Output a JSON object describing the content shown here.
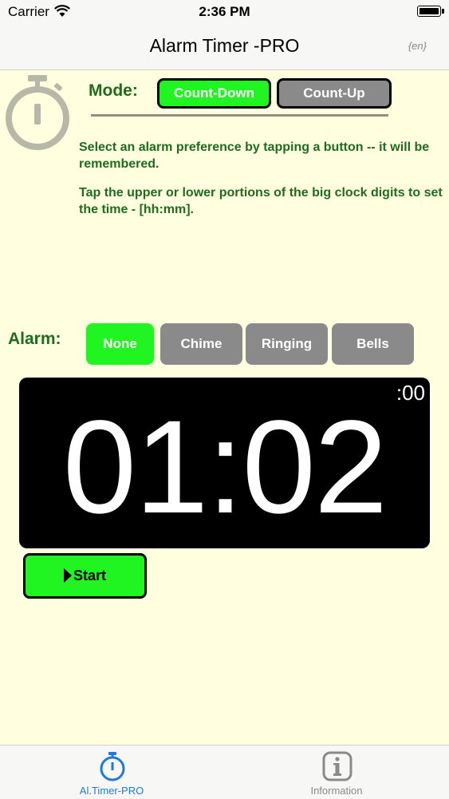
{
  "status_bar": {
    "carrier": "Carrier",
    "time": "2:36 PM"
  },
  "nav": {
    "title": "Alarm Timer -PRO",
    "language": "{en}"
  },
  "mode": {
    "label": "Mode:",
    "count_down": "Count-Down",
    "count_up": "Count-Up",
    "selected": "Count-Down"
  },
  "instructions": {
    "line1": "Select an alarm preference by tapping a button -- it will be remembered.",
    "line2": "Tap the upper or lower portions of the big clock digits to set the time - [hh:mm]."
  },
  "alarm": {
    "label": "Alarm:",
    "options": [
      "None",
      "Chime",
      "Ringing",
      "Bells"
    ],
    "selected": "None"
  },
  "clock": {
    "time": "01:02",
    "seconds": ":00"
  },
  "start_button": {
    "label": "Start"
  },
  "tabs": [
    {
      "label": "Al.Timer-PRO",
      "icon": "stopwatch-icon",
      "active": true
    },
    {
      "label": "Information",
      "icon": "info-icon",
      "active": false
    }
  ],
  "colors": {
    "background": "#ffffdf",
    "accent_green": "#21f521",
    "text_green": "#1f6b1f",
    "inactive_gray": "#8a8a8a",
    "tab_active": "#1e7ae0"
  }
}
